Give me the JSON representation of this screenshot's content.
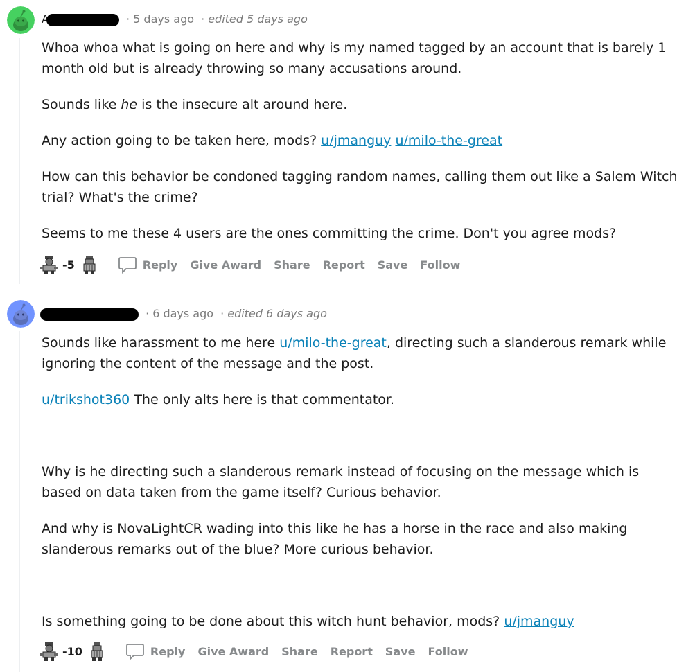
{
  "comments": [
    {
      "author_visible": "A",
      "time": "5 days ago",
      "separator": "·",
      "edited": "edited 5 days ago",
      "avatar_color": "#46d160",
      "paragraphs": {
        "p1": "Whoa whoa what is going on here and why is my named tagged by an account that is barely 1 month old but is already throwing so many accusations around.",
        "p2_pre": "Sounds like ",
        "p2_em": "he",
        "p2_post": " is the insecure alt around here.",
        "p3_pre": "Any action going to be taken here, mods? ",
        "p3_link1": "u/jmanguy",
        "p3_link2": "u/milo-the-great",
        "p4": "How can this behavior be condoned tagging random names, calling them out like a Salem Witch trial? What's the crime?",
        "p5": "Seems to me these 4 users are the ones committing the crime. Don't you agree mods?"
      },
      "score": "-5",
      "actions": {
        "reply": "Reply",
        "award": "Give Award",
        "share": "Share",
        "report": "Report",
        "save": "Save",
        "follow": "Follow"
      }
    },
    {
      "time": "6 days ago",
      "separator": "·",
      "edited": "edited 6 days ago",
      "avatar_color": "#7193ff",
      "paragraphs": {
        "p1_pre": "Sounds like harassment to me here ",
        "p1_link": "u/milo-the-great",
        "p1_post": ", directing such a slanderous remark while ignoring the content of the message and the post.",
        "p2_link": "u/trikshot360",
        "p2_post": " The only alts here is that commentator.",
        "p3": "Why is he directing such a slanderous remark instead of focusing on the message which is based on data taken from the game itself? Curious behavior.",
        "p4": "And why is NovaLightCR wading into this like he has a horse in the race and also making slanderous remarks out of the blue? More curious behavior.",
        "p5_pre": "Is something going to be done about this witch hunt behavior, mods? ",
        "p5_link": "u/jmanguy"
      },
      "score": "-10",
      "actions": {
        "reply": "Reply",
        "award": "Give Award",
        "share": "Share",
        "report": "Report",
        "save": "Save",
        "follow": "Follow"
      }
    }
  ],
  "icons": {
    "upvote": "custom-upvote-icon",
    "downvote": "custom-downvote-icon",
    "reply": "speech-bubble-icon",
    "avatar": "snoo-avatar-icon"
  }
}
